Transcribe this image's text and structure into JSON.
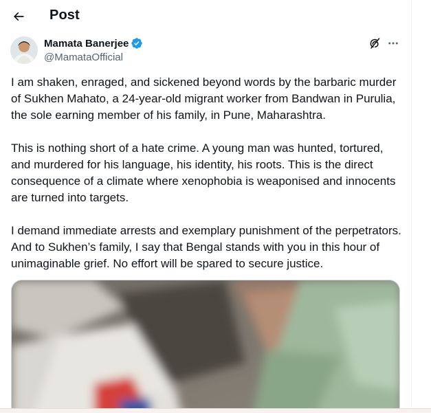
{
  "header": {
    "title": "Post",
    "back_icon": "arrow-left-icon"
  },
  "author": {
    "display_name": "Mamata Banerjee",
    "handle": "@MamataOfficial",
    "verified_icon": "verified-badge-icon",
    "verified_color": "#1d9bf0"
  },
  "actions": {
    "grok_icon": "grok-icon",
    "more_icon": "more-dots-icon"
  },
  "tweet": {
    "paragraphs": [
      "I am shaken, enraged, and sickened beyond words by the barbaric murder of Sukhen Mahato, a 24-year-old migrant worker from Bandwan in Purulia, the sole earning member of his family, in Pune, Maharashtra.",
      "This is nothing short of a hate crime. A young man was hunted, tortured, and murdered for his language, his identity, his roots. This is the direct consequence of a climate where xenophobia is weaponised and innocents are turned into targets.",
      "I demand immediate arrests and exemplary punishment of the perpetrators. And to Sukhen’s family, I say that Bengal stands with you in this hour of unimaginable grief. No effort will be spared to secure justice."
    ]
  }
}
